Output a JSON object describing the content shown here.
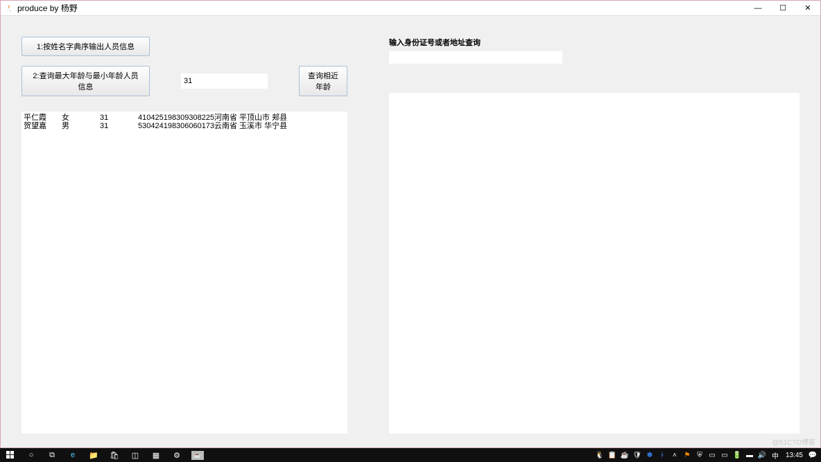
{
  "window": {
    "title": "produce by 杨野"
  },
  "buttons": {
    "btn1": "1:按姓名字典序输出人员信息",
    "btn2": "2:查询最大年龄与最小年龄人员信息",
    "btn3": "查询相近年龄"
  },
  "inputs": {
    "age_value": "31",
    "right_label": "输入身份证号或者地址查询"
  },
  "table": {
    "rows": [
      {
        "name": "平仁霞",
        "gender": "女",
        "age": "31",
        "id": "410425198309308225",
        "address": "河南省 平顶山市 郏县"
      },
      {
        "name": "贺望嘉",
        "gender": "男",
        "age": "31",
        "id": "530424198306060173",
        "address": "云南省 玉溪市 华宁县"
      }
    ]
  },
  "taskbar": {
    "ime": "中",
    "clock": "13:45"
  },
  "watermark": "@51CTO博客"
}
